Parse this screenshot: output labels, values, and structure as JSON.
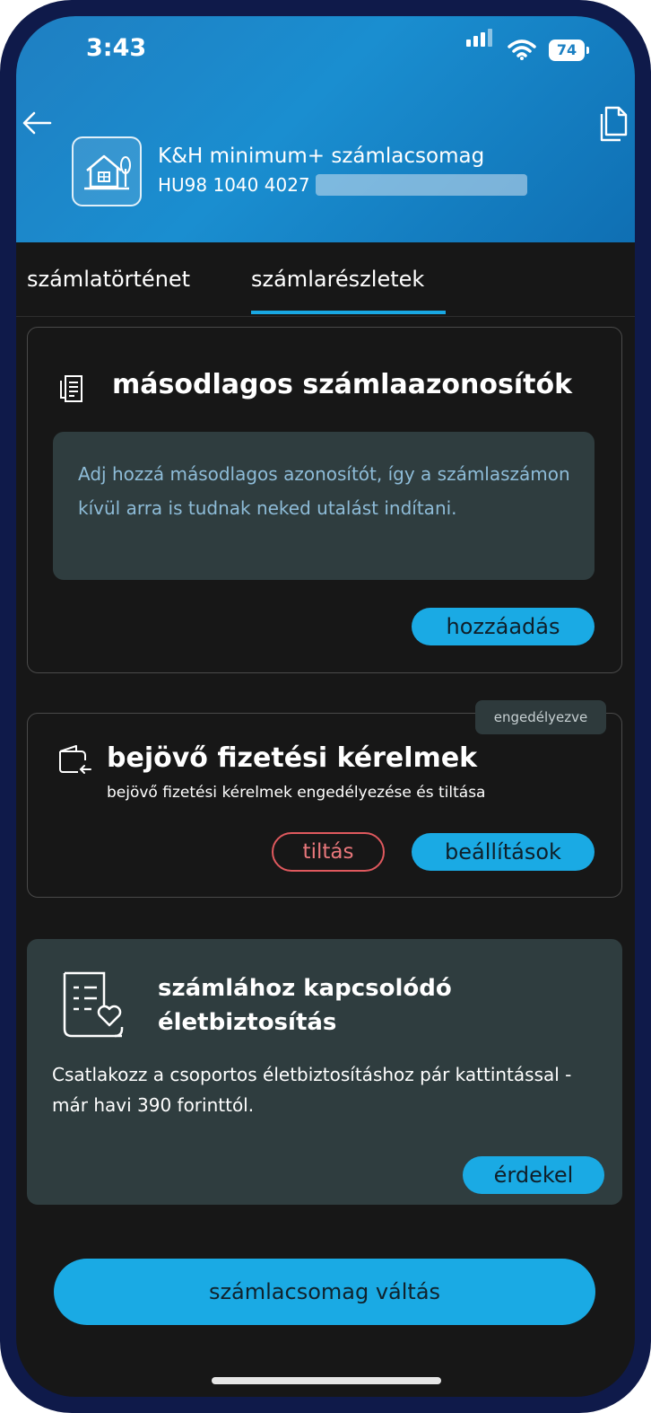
{
  "status_bar": {
    "time": "3:43",
    "battery": "74"
  },
  "account": {
    "name": "K&H minimum+ számlacsomag",
    "iban_visible": "HU98 1040 4027"
  },
  "tabs": [
    {
      "label": "számlatörténet",
      "active": false
    },
    {
      "label": "számlarészletek",
      "active": true
    }
  ],
  "secondary_ids": {
    "title": "másodlagos számlaazonosítók",
    "info": "Adj hozzá másodlagos azonosítót, így a számlaszámon kívül arra is tudnak neked utalást indítani.",
    "add_button": "hozzáadás"
  },
  "payment_requests": {
    "badge": "engedélyezve",
    "title": "bejövő fizetési kérelmek",
    "subtitle": "bejövő fizetési kérelmek engedélyezése és tiltása",
    "block_button": "tiltás",
    "settings_button": "beállítások"
  },
  "insurance": {
    "title_line1": "számlához kapcsolódó",
    "title_line2": "életbiztosítás",
    "text": "Csatlakozz a csoportos életbiztosításhoz pár kattintással - már havi 390 forinttól.",
    "button": "érdekel"
  },
  "bottom_button": "számlacsomag váltás",
  "colors": {
    "accent": "#1aaae4",
    "danger": "#e0595e",
    "background": "#171717",
    "panel": "#2f3d3f"
  },
  "icons": [
    "back-arrow-icon",
    "document-icon",
    "house-icon",
    "list-document-icon",
    "wallet-transfer-icon",
    "heart-document-icon"
  ]
}
